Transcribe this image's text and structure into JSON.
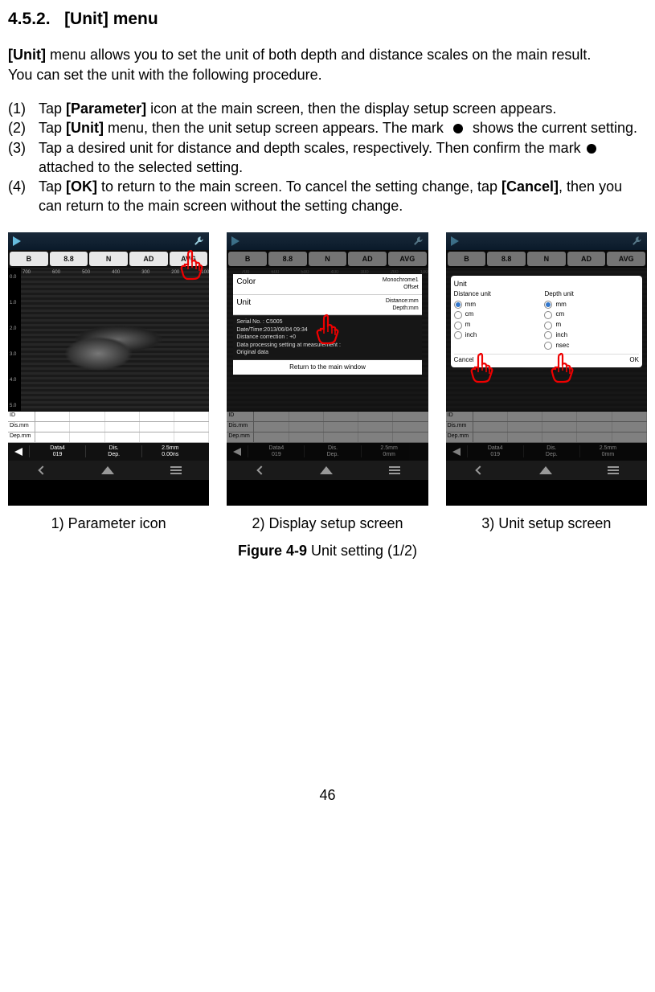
{
  "heading": {
    "number": "4.5.2.",
    "title": "[Unit] menu"
  },
  "intro": {
    "line1a": "[Unit]",
    "line1b": " menu allows you to set the unit of both depth and distance scales on the main result.",
    "line2": "You can set the unit with the following procedure."
  },
  "steps": [
    {
      "num": "(1)",
      "pre": "Tap ",
      "bold1": "[Parameter]",
      "post1": " icon at the main screen, then the display setup screen appears."
    },
    {
      "num": "(2)",
      "pre": "Tap ",
      "bold1": "[Unit]",
      "post1": " menu, then the unit setup screen appears. The mark  ●  shows the current setting."
    },
    {
      "num": "(3)",
      "pre": "Tap a desired unit for distance and depth scales, respectively. Then confirm the mark ●  attached to the selected setting."
    },
    {
      "num": "(4)",
      "pre": "Tap ",
      "bold1": "[OK]",
      "post1": " to return to the main screen. To cancel the setting change, tap ",
      "bold2": "[Cancel]",
      "post2": ", then you can return to the main screen without the setting change."
    }
  ],
  "pills": [
    "B",
    "8.8",
    "N",
    "AD",
    "AVG"
  ],
  "ruler_ticks": [
    "700",
    "600",
    "500",
    "400",
    "300",
    "200",
    "100"
  ],
  "vscale": [
    "0.0",
    "1.0",
    "2.0",
    "3.0",
    "4.0",
    "5.0"
  ],
  "table_labels": {
    "id": "ID",
    "dis": "Dis.mm",
    "dep": "Dep.mm"
  },
  "footer": {
    "data": "Data4",
    "data_sub": "019",
    "dis": "Dis.",
    "dep": "Dep.",
    "val1": "2.5mm",
    "val2": "0.00ns",
    "val2b": "0mm"
  },
  "popup2": {
    "color_label": "Color",
    "color_val": "Monochrome1\nOffset",
    "unit_label": "Unit",
    "unit_val": "Distance:mm\nDepth:mm",
    "info1": "Serial No. : C5005",
    "info2": "Date/Time:2013/06/04  09:34",
    "info3": "Distance correction : +0",
    "info4": "Data processing setting at measurement :",
    "info5": "Original data",
    "return": "Return to the main window"
  },
  "popup3": {
    "title": "Unit",
    "dist_label": "Distance unit",
    "depth_label": "Depth unit",
    "options": [
      "mm",
      "cm",
      "m",
      "inch"
    ],
    "depth_extra": "nsec",
    "selected": "mm",
    "cancel": "Cancel",
    "ok": "OK"
  },
  "captions": {
    "c1": "1) Parameter icon",
    "c2": "2) Display setup screen",
    "c3": "3) Unit setup screen"
  },
  "figure": {
    "bold": "Figure 4-9",
    "rest": " Unit setting (1/2)"
  },
  "page": "46"
}
